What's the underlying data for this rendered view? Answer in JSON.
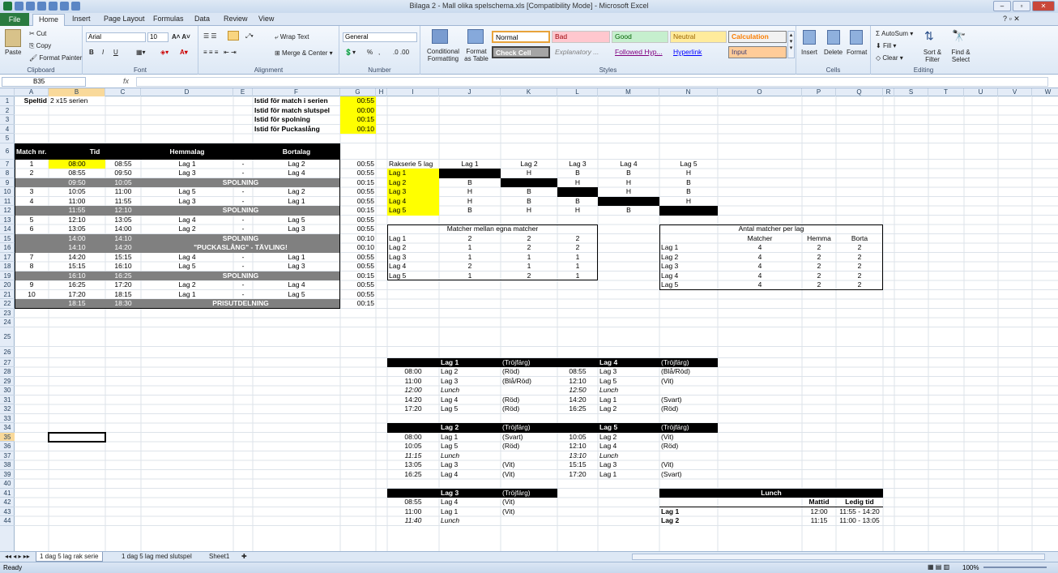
{
  "window": {
    "title": "Bilaga 2 - Mall olika spelschema.xls  [Compatibility Mode]  -  Microsoft Excel"
  },
  "tabs": [
    "File",
    "Home",
    "Insert",
    "Page Layout",
    "Formulas",
    "Data",
    "Review",
    "View"
  ],
  "ribbon": {
    "clipboard": {
      "label": "Clipboard",
      "paste": "Paste",
      "cut": "Cut",
      "copy": "Copy",
      "format_painter": "Format Painter"
    },
    "font": {
      "label": "Font",
      "family": "Arial",
      "size": "10",
      "bold": "B",
      "italic": "I",
      "underline": "U"
    },
    "alignment": {
      "label": "Alignment",
      "wrap": "Wrap Text",
      "merge": "Merge & Center"
    },
    "number": {
      "label": "Number",
      "format": "General",
      "pct": "%",
      "comma": ","
    },
    "styles": {
      "label": "Styles",
      "conditional": "Conditional Formatting",
      "format_table": "Format as Table",
      "cells": [
        "Normal",
        "Bad",
        "Good",
        "Neutral",
        "Calculation",
        "Check Cell",
        "Explanatory ...",
        "Followed Hyp...",
        "Hyperlink",
        "Input"
      ]
    },
    "cells": {
      "label": "Cells",
      "insert": "Insert",
      "delete": "Delete",
      "format": "Format"
    },
    "editing": {
      "label": "Editing",
      "autosum": "AutoSum",
      "fill": "Fill",
      "clear": "Clear",
      "sort": "Sort & Filter",
      "find": "Find & Select"
    }
  },
  "formula": {
    "namebox": "B35",
    "fx": "fx",
    "value": ""
  },
  "columns": [
    "A",
    "B",
    "C",
    "D",
    "E",
    "F",
    "G",
    "H",
    "I",
    "J",
    "K",
    "L",
    "M",
    "N",
    "O",
    "P",
    "Q",
    "R",
    "S",
    "T",
    "U",
    "V",
    "W"
  ],
  "rows": [
    "1",
    "2",
    "3",
    "4",
    "5",
    "6",
    "7",
    "8",
    "9",
    "10",
    "11",
    "12",
    "13",
    "14",
    "15",
    "16",
    "17",
    "18",
    "19",
    "20",
    "21",
    "22",
    "23",
    "24",
    "25",
    "26",
    "27",
    "28",
    "29",
    "30",
    "31",
    "32",
    "33",
    "34",
    "35",
    "36",
    "37",
    "38",
    "39",
    "40",
    "41",
    "42",
    "43",
    "44"
  ],
  "header": {
    "speltid_label": "Speltid",
    "speltid_value": "2 x15 serien",
    "istid": [
      {
        "label": "Istid för match i serien",
        "value": "00:55"
      },
      {
        "label": "Istid för match slutspel",
        "value": "00:00"
      },
      {
        "label": "Istid för spolning",
        "value": "00:15"
      },
      {
        "label": "Istid för Puckaslång",
        "value": "00:10"
      }
    ]
  },
  "schedule": {
    "col_match": "Match nr.",
    "col_tid": "Tid",
    "col_home": "Hemmalag",
    "col_away": "Bortalag",
    "rows": [
      {
        "type": "m",
        "nr": "1",
        "start": "08:00",
        "end": "08:55",
        "home": "Lag 1",
        "sep": "-",
        "away": "Lag 2",
        "g": "00:55"
      },
      {
        "type": "m",
        "nr": "2",
        "start": "08:55",
        "end": "09:50",
        "home": "Lag 3",
        "sep": "-",
        "away": "Lag 4",
        "g": "00:55"
      },
      {
        "type": "s",
        "start": "09:50",
        "end": "10:05",
        "text": "SPOLNING",
        "g": "00:15"
      },
      {
        "type": "m",
        "nr": "3",
        "start": "10:05",
        "end": "11:00",
        "home": "Lag 5",
        "sep": "-",
        "away": "Lag 2",
        "g": "00:55"
      },
      {
        "type": "m",
        "nr": "4",
        "start": "11:00",
        "end": "11:55",
        "home": "Lag 3",
        "sep": "-",
        "away": "Lag 1",
        "g": "00:55"
      },
      {
        "type": "s",
        "start": "11:55",
        "end": "12:10",
        "text": "SPOLNING",
        "g": "00:15"
      },
      {
        "type": "m",
        "nr": "5",
        "start": "12:10",
        "end": "13:05",
        "home": "Lag 4",
        "sep": "-",
        "away": "Lag 5",
        "g": "00:55"
      },
      {
        "type": "m",
        "nr": "6",
        "start": "13:05",
        "end": "14:00",
        "home": "Lag 2",
        "sep": "-",
        "away": "Lag 3",
        "g": "00:55"
      },
      {
        "type": "s",
        "start": "14:00",
        "end": "14:10",
        "text": "SPOLNING",
        "g": "00:10"
      },
      {
        "type": "s",
        "start": "14:10",
        "end": "14:20",
        "text": "\"PUCKASLÅNG\" - TÄVLING!",
        "g": "00:10"
      },
      {
        "type": "m",
        "nr": "7",
        "start": "14:20",
        "end": "15:15",
        "home": "Lag 4",
        "sep": "-",
        "away": "Lag 1",
        "g": "00:55"
      },
      {
        "type": "m",
        "nr": "8",
        "start": "15:15",
        "end": "16:10",
        "home": "Lag 5",
        "sep": "-",
        "away": "Lag 3",
        "g": "00:55"
      },
      {
        "type": "s",
        "start": "16:10",
        "end": "16:25",
        "text": "SPOLNING",
        "g": "00:15"
      },
      {
        "type": "m",
        "nr": "9",
        "start": "16:25",
        "end": "17:20",
        "home": "Lag 2",
        "sep": "-",
        "away": "Lag 4",
        "g": "00:55"
      },
      {
        "type": "m",
        "nr": "10",
        "start": "17:20",
        "end": "18:15",
        "home": "Lag 1",
        "sep": "-",
        "away": "Lag 5",
        "g": "00:55"
      },
      {
        "type": "s",
        "start": "18:15",
        "end": "18:30",
        "text": "PRISUTDELNING",
        "g": "00:15"
      }
    ]
  },
  "matrix": {
    "title": "Rakserie 5 lag",
    "teams": [
      "Lag 1",
      "Lag 2",
      "Lag 3",
      "Lag 4",
      "Lag 5"
    ],
    "cells": [
      [
        "X",
        "H",
        "B",
        "B",
        "H"
      ],
      [
        "B",
        "X",
        "H",
        "H",
        "B"
      ],
      [
        "H",
        "B",
        "X",
        "H",
        "B"
      ],
      [
        "H",
        "B",
        "B",
        "X",
        "H"
      ],
      [
        "B",
        "H",
        "H",
        "B",
        "X"
      ]
    ]
  },
  "mutual": {
    "title": "Matcher mellan egna matcher",
    "rows": [
      [
        "Lag 1",
        "2",
        "2",
        "2"
      ],
      [
        "Lag 2",
        "1",
        "2",
        "2"
      ],
      [
        "Lag 3",
        "1",
        "1",
        "1"
      ],
      [
        "Lag 4",
        "2",
        "1",
        "1"
      ],
      [
        "Lag 5",
        "1",
        "2",
        "1"
      ]
    ]
  },
  "antal": {
    "title": "Antal matcher per lag",
    "headers": [
      "Matcher",
      "Hemma",
      "Borta"
    ],
    "rows": [
      [
        "Lag 1",
        "4",
        "2",
        "2"
      ],
      [
        "Lag 2",
        "4",
        "2",
        "2"
      ],
      [
        "Lag 3",
        "4",
        "2",
        "2"
      ],
      [
        "Lag 4",
        "4",
        "2",
        "2"
      ],
      [
        "Lag 5",
        "4",
        "2",
        "2"
      ]
    ]
  },
  "teamcards": [
    {
      "title": "Lag 1",
      "sub": "(Tröjfärg)",
      "rows": [
        [
          "08:00",
          "Lag 2",
          "(Röd)"
        ],
        [
          "11:00",
          "Lag 3",
          "(Blå/Röd)"
        ],
        [
          "12:00",
          "Lunch",
          ""
        ],
        [
          "14:20",
          "Lag 4",
          "(Röd)"
        ],
        [
          "17:20",
          "Lag 5",
          "(Röd)"
        ]
      ]
    },
    {
      "title": "Lag 4",
      "sub": "(Tröjfärg)",
      "rows": [
        [
          "08:55",
          "Lag 3",
          "(Blå/Röd)"
        ],
        [
          "12:10",
          "Lag 5",
          "(Vit)"
        ],
        [
          "12:50",
          "Lunch",
          ""
        ],
        [
          "14:20",
          "Lag 1",
          "(Svart)"
        ],
        [
          "16:25",
          "Lag 2",
          "(Röd)"
        ]
      ]
    },
    {
      "title": "Lag 2",
      "sub": "(Tröjfärg)",
      "rows": [
        [
          "08:00",
          "Lag 1",
          "(Svart)"
        ],
        [
          "10:05",
          "Lag 5",
          "(Röd)"
        ],
        [
          "11:15",
          "Lunch",
          ""
        ],
        [
          "13:05",
          "Lag 3",
          "(Vit)"
        ],
        [
          "16:25",
          "Lag 4",
          "(Vit)"
        ]
      ]
    },
    {
      "title": "Lag 5",
      "sub": "(Tröjfärg)",
      "rows": [
        [
          "10:05",
          "Lag 2",
          "(Vit)"
        ],
        [
          "12:10",
          "Lag 4",
          "(Röd)"
        ],
        [
          "13:10",
          "Lunch",
          ""
        ],
        [
          "15:15",
          "Lag 3",
          "(Vit)"
        ],
        [
          "17:20",
          "Lag 1",
          "(Svart)"
        ]
      ]
    },
    {
      "title": "Lag 3",
      "sub": "(Tröjfärg)",
      "rows": [
        [
          "08:55",
          "Lag 4",
          "(Vit)"
        ],
        [
          "11:00",
          "Lag 1",
          "(Vit)"
        ],
        [
          "11:40",
          "Lunch",
          ""
        ]
      ]
    }
  ],
  "lunch": {
    "title": "Lunch",
    "headers": [
      "Mattid",
      "Ledig tid"
    ],
    "rows": [
      [
        "Lag 1",
        "12:00",
        "11:55  -  14:20"
      ],
      [
        "Lag 2",
        "11:15",
        "11:00  -  13:05"
      ]
    ]
  },
  "sheets": [
    "1 dag 5 lag rak serie",
    "1 dag 5 lag med slutspel",
    "Sheet1"
  ],
  "status": {
    "ready": "Ready",
    "zoom": "100%"
  }
}
